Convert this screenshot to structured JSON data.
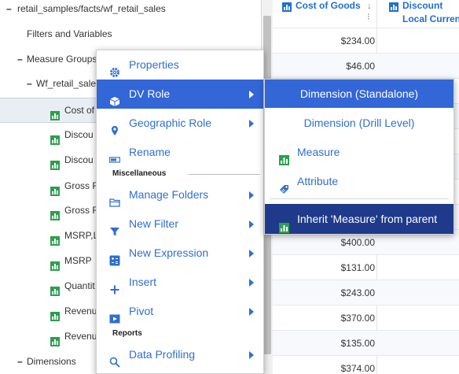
{
  "tree": {
    "root_label": "retail_samples/facts/wf_retail_sales",
    "filters_label": "Filters and Variables",
    "measure_groups_label": "Measure Groups",
    "group_label": "Wf_retail_sale",
    "measures": [
      "Cost of",
      "Discou",
      "Discou",
      "Gross F",
      "Gross F",
      "MSRP,L",
      "MSRP",
      "Quantit",
      "Revenu",
      "Revenu"
    ],
    "dimensions_label": "Dimensions"
  },
  "grid": {
    "col1_header": "Cost of Goods",
    "col1_sort": "↓ ⁝",
    "col2_header_line1": "Discount",
    "col2_header_line2": "Local Curren",
    "values": [
      "$234.00",
      "$46.00",
      "",
      "",
      "",
      "",
      "",
      "",
      "",
      "$400.00",
      "$131.00",
      "$243.00",
      "$370.00",
      "$135.00",
      "$374.00"
    ]
  },
  "context_menu": {
    "items": [
      {
        "label": "Properties",
        "icon": "gear-icon",
        "submenu": false
      },
      {
        "label": "DV Role",
        "icon": "cube-icon",
        "submenu": true
      },
      {
        "label": "Geographic Role",
        "icon": "map-pin-icon",
        "submenu": true
      },
      {
        "label": "Rename",
        "icon": "rename-icon",
        "submenu": false
      }
    ],
    "section_misc": "Miscellaneous",
    "misc_items": [
      {
        "label": "Manage Folders",
        "icon": "folder-icon",
        "submenu": true
      },
      {
        "label": "New Filter",
        "icon": "filter-icon",
        "submenu": true
      },
      {
        "label": "New Expression",
        "icon": "expression-icon",
        "submenu": true
      },
      {
        "label": "Insert",
        "icon": "plus-icon",
        "submenu": true
      },
      {
        "label": "Pivot",
        "icon": "pivot-icon",
        "submenu": true
      }
    ],
    "section_reports": "Reports",
    "report_items": [
      {
        "label": "Data Profiling",
        "icon": "search-icon",
        "submenu": true
      }
    ]
  },
  "submenu": {
    "items": [
      {
        "label": "Dimension (Standalone)"
      },
      {
        "label": "Dimension (Drill Level)"
      },
      {
        "label": "Measure",
        "icon": "measure-icon"
      },
      {
        "label": "Attribute",
        "icon": "tag-icon"
      },
      {
        "label": "Inherit 'Measure' from parent",
        "icon": "measure-icon"
      }
    ]
  },
  "colors": {
    "accent": "#3366d6",
    "accent_dark": "#1f3a8a",
    "link": "#2f6fce",
    "measure_green": "#2e9e4f"
  }
}
